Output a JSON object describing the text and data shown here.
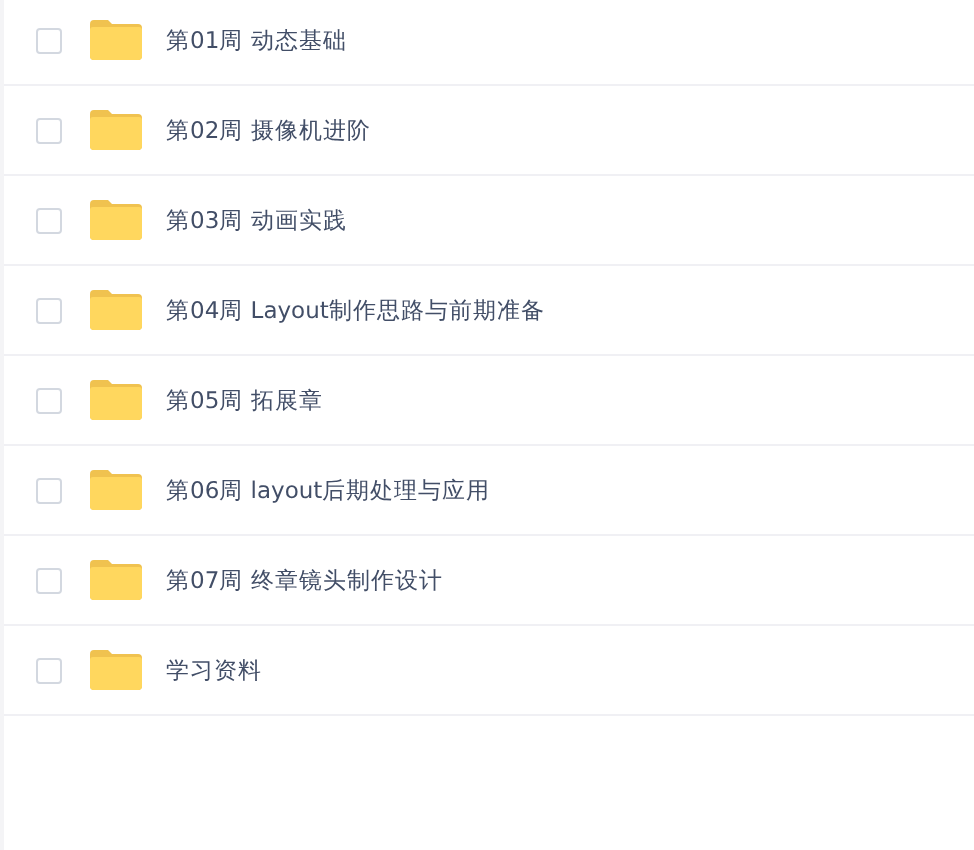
{
  "files": [
    {
      "name": "第01周 动态基础",
      "checked": false
    },
    {
      "name": "第02周 摄像机进阶",
      "checked": false
    },
    {
      "name": "第03周 动画实践",
      "checked": false
    },
    {
      "name": "第04周 Layout制作思路与前期准备",
      "checked": false
    },
    {
      "name": "第05周 拓展章",
      "checked": false
    },
    {
      "name": "第06周 layout后期处理与应用",
      "checked": false
    },
    {
      "name": "第07周 终章镜头制作设计",
      "checked": false
    },
    {
      "name": "学习资料",
      "checked": false
    }
  ]
}
